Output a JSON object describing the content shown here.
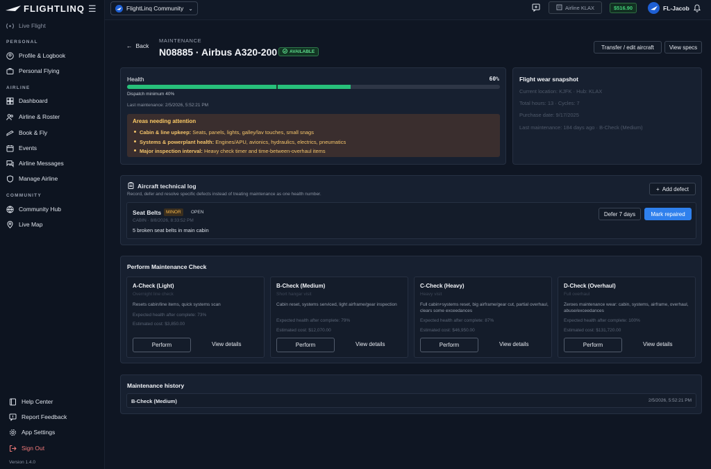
{
  "app": {
    "brand": "FLIGHTLINQ",
    "version": "Version 1.4.0"
  },
  "sidebar": {
    "live_flight": "Live Flight",
    "sections": {
      "personal": "PERSONAL",
      "airline": "AIRLINE",
      "community": "COMMUNITY"
    },
    "personal_items": [
      "Profile & Logbook",
      "Personal Flying"
    ],
    "airline_items": [
      "Dashboard",
      "Airline & Roster",
      "Book & Fly",
      "Events",
      "Airline Messages",
      "Manage Airline"
    ],
    "community_items": [
      "Community Hub",
      "Live Map"
    ],
    "footer_items": [
      "Help Center",
      "Report Feedback",
      "App Settings"
    ],
    "sign_out": "Sign Out"
  },
  "topbar": {
    "community": "FlightLinq Community",
    "airline": "Airline KLAX",
    "balance": "$516.90",
    "user": "FL-Jacob"
  },
  "header": {
    "back": "Back",
    "section": "MAINTENANCE",
    "title": "N08885 · Airbus A320-200",
    "status": "AVAILABLE",
    "transfer": "Transfer / edit aircraft",
    "specs": "View specs"
  },
  "health": {
    "title": "Health",
    "percent": "60%",
    "percent_value": 0.6,
    "dispatch": "Dispatch minimum 40%",
    "last_maintenance": "Last maintenance: 2/5/2026, 5:52:21 PM",
    "attention_title": "Areas needing attention",
    "attention_items": [
      {
        "label": "Cabin & line upkeep:",
        "text": "Seats, panels, lights, galley/lav touches, small snags"
      },
      {
        "label": "Systems & powerplant health:",
        "text": "Engines/APU, avionics, hydraulics, electrics, pneumatics"
      },
      {
        "label": "Major inspection interval:",
        "text": "Heavy check timer and time-between-overhaul items"
      }
    ]
  },
  "snapshot": {
    "title": "Flight wear snapshot",
    "lines": [
      "Current location: KJFK · Hub: KLAX",
      "Total hours: 13 · Cycles: 7",
      "Purchase date: 9/17/2025",
      "Last maintenance: 184 days ago · B-Check (Medium)"
    ]
  },
  "techlog": {
    "title": "Aircraft technical log",
    "subtitle": "Record, defer and resolve specific defects instead of treating maintenance as one health number.",
    "add": "Add defect",
    "defect": {
      "name": "Seat Belts",
      "severity": "MINOR",
      "status": "OPEN",
      "meta": "CABIN · 8/8/2026, 8:33:52 PM",
      "description": "5 broken seat belts in main cabin",
      "defer": "Defer 7 days",
      "repair": "Mark repaired"
    }
  },
  "checks": {
    "title": "Perform Maintenance Check",
    "perform_label": "Perform",
    "details_label": "View details",
    "items": [
      {
        "name": "A-Check (Light)",
        "sub": "Overnight line check",
        "desc": "Resets cabin/line items, quick systems scan",
        "expected": "Expected health after complete: 73%",
        "cost": "Estimated cost: $3,850.00"
      },
      {
        "name": "B-Check (Medium)",
        "sub": "Short hangar visit",
        "desc": "Cabin reset, systems serviced, light airframe/gear inspection",
        "expected": "Expected health after complete: 79%",
        "cost": "Estimated cost: $12,070.00"
      },
      {
        "name": "C-Check (Heavy)",
        "sub": "Heavy visit",
        "desc": "Full cabin+systems reset, big airframe/gear cut, partial overhaul, clears some exceedances",
        "expected": "Expected health after complete: 87%",
        "cost": "Estimated cost: $46,950.00"
      },
      {
        "name": "D-Check (Overhaul)",
        "sub": "Full overhaul",
        "desc": "Zeroes maintenance wear: cabin, systems, airframe, overhaul, abuse/exceedances",
        "expected": "Expected health after complete: 100%",
        "cost": "Estimated cost: $131,720.00"
      }
    ]
  },
  "history": {
    "title": "Maintenance history",
    "entries": [
      {
        "name": "B-Check (Medium)",
        "date": "2/5/2026, 5:52:21 PM"
      }
    ]
  },
  "colors": {
    "accent": "#2f80ed",
    "success": "#27c07a",
    "warning": "#f5c56b",
    "danger": "#f27a7a"
  }
}
